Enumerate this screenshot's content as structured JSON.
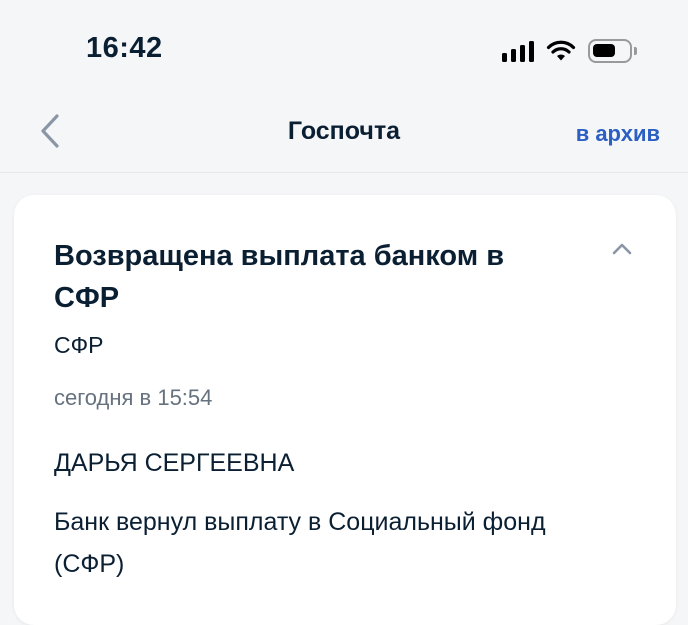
{
  "status_bar": {
    "time": "16:42",
    "icons": [
      "signal-icon",
      "wifi-icon",
      "battery-icon"
    ]
  },
  "nav": {
    "back_icon": "chevron-left-icon",
    "title": "Госпочта",
    "archive_label": "в архив"
  },
  "message": {
    "title": "Возвращена выплата банком в СФР",
    "sender": "СФР",
    "date": "сегодня в 15:54",
    "recipient": "ДАРЬЯ СЕРГЕЕВНА",
    "body": "Банк вернул выплату в Социальный фонд (СФР)",
    "collapse_icon": "chevron-up-icon"
  },
  "colors": {
    "background": "#f5f6f8",
    "card": "#ffffff",
    "text": "#0b1f33",
    "secondary_text": "#66727f",
    "accent": "#2c5fc4",
    "icon_gray": "#8a96a6"
  }
}
